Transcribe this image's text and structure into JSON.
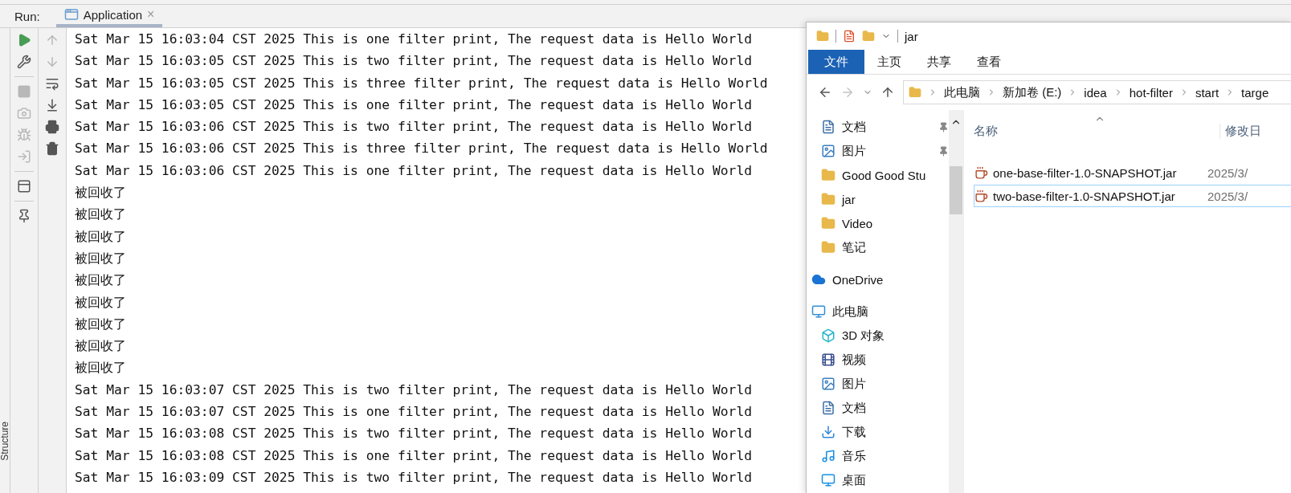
{
  "run_panel": {
    "label": "Run:",
    "tab": {
      "title": "Application",
      "close": "×",
      "selected": true
    },
    "toolbar_primary": [
      {
        "kind": "run",
        "disabled": false
      },
      {
        "kind": "wrench",
        "disabled": false
      },
      {
        "kind": "stop",
        "disabled": true
      },
      {
        "kind": "camera",
        "disabled": true
      },
      {
        "kind": "bug",
        "disabled": true
      },
      {
        "kind": "login",
        "disabled": true
      },
      {
        "kind": "layout",
        "disabled": false
      },
      {
        "kind": "pin",
        "disabled": false
      }
    ],
    "toolbar_secondary": [
      {
        "kind": "up",
        "disabled": true
      },
      {
        "kind": "down",
        "disabled": true
      },
      {
        "kind": "wrap",
        "disabled": false
      },
      {
        "kind": "scroll-end",
        "disabled": false
      },
      {
        "kind": "print",
        "disabled": false
      },
      {
        "kind": "trash",
        "disabled": false
      }
    ],
    "console_lines": [
      "Sat Mar 15 16:03:04 CST 2025 This is one filter print, The request data is Hello World",
      "Sat Mar 15 16:03:05 CST 2025 This is two filter print, The request data is Hello World",
      "Sat Mar 15 16:03:05 CST 2025 This is three filter print, The request data is Hello World",
      "Sat Mar 15 16:03:05 CST 2025 This is one filter print, The request data is Hello World",
      "Sat Mar 15 16:03:06 CST 2025 This is two filter print, The request data is Hello World",
      "Sat Mar 15 16:03:06 CST 2025 This is three filter print, The request data is Hello World",
      "Sat Mar 15 16:03:06 CST 2025 This is one filter print, The request data is Hello World",
      "被回收了",
      "被回收了",
      "被回收了",
      "被回收了",
      "被回收了",
      "被回收了",
      "被回收了",
      "被回收了",
      "被回收了",
      "Sat Mar 15 16:03:07 CST 2025 This is two filter print, The request data is Hello World",
      "Sat Mar 15 16:03:07 CST 2025 This is one filter print, The request data is Hello World",
      "Sat Mar 15 16:03:08 CST 2025 This is two filter print, The request data is Hello World",
      "Sat Mar 15 16:03:08 CST 2025 This is one filter print, The request data is Hello World",
      "Sat Mar 15 16:03:09 CST 2025 This is two filter print, The request data is Hello World"
    ],
    "side_tool_window": "Structure"
  },
  "explorer": {
    "title": "jar",
    "ribbon_tabs": [
      {
        "label": "文件",
        "selected": true
      },
      {
        "label": "主页",
        "selected": false
      },
      {
        "label": "共享",
        "selected": false
      },
      {
        "label": "查看",
        "selected": false
      }
    ],
    "path": [
      "此电脑",
      "新加卷 (E:)",
      "idea",
      "hot-filter",
      "start",
      "targe"
    ],
    "quick_access_items": [
      {
        "label": "文档",
        "kind": "document",
        "pinned": true
      },
      {
        "label": "图片",
        "kind": "picture",
        "pinned": true
      },
      {
        "label": "Good Good Stu",
        "kind": "folder",
        "pinned": false
      },
      {
        "label": "jar",
        "kind": "folder",
        "pinned": false
      },
      {
        "label": "Video",
        "kind": "folder",
        "pinned": false
      },
      {
        "label": "笔记",
        "kind": "folder",
        "pinned": false
      }
    ],
    "roots": [
      {
        "label": "OneDrive",
        "kind": "cloud"
      },
      {
        "label": "此电脑",
        "kind": "computer",
        "children": [
          {
            "label": "3D 对象",
            "kind": "cube"
          },
          {
            "label": "视频",
            "kind": "video"
          },
          {
            "label": "图片",
            "kind": "picture"
          },
          {
            "label": "文档",
            "kind": "document"
          },
          {
            "label": "下载",
            "kind": "download"
          },
          {
            "label": "音乐",
            "kind": "music"
          },
          {
            "label": "桌面",
            "kind": "desktop"
          }
        ]
      }
    ],
    "columns": [
      "名称",
      "修改日"
    ],
    "files": [
      {
        "name": "one-base-filter-1.0-SNAPSHOT.jar",
        "date": "2025/3/",
        "selected": false
      },
      {
        "name": "two-base-filter-1.0-SNAPSHOT.jar",
        "date": "2025/3/",
        "selected": true
      }
    ]
  }
}
